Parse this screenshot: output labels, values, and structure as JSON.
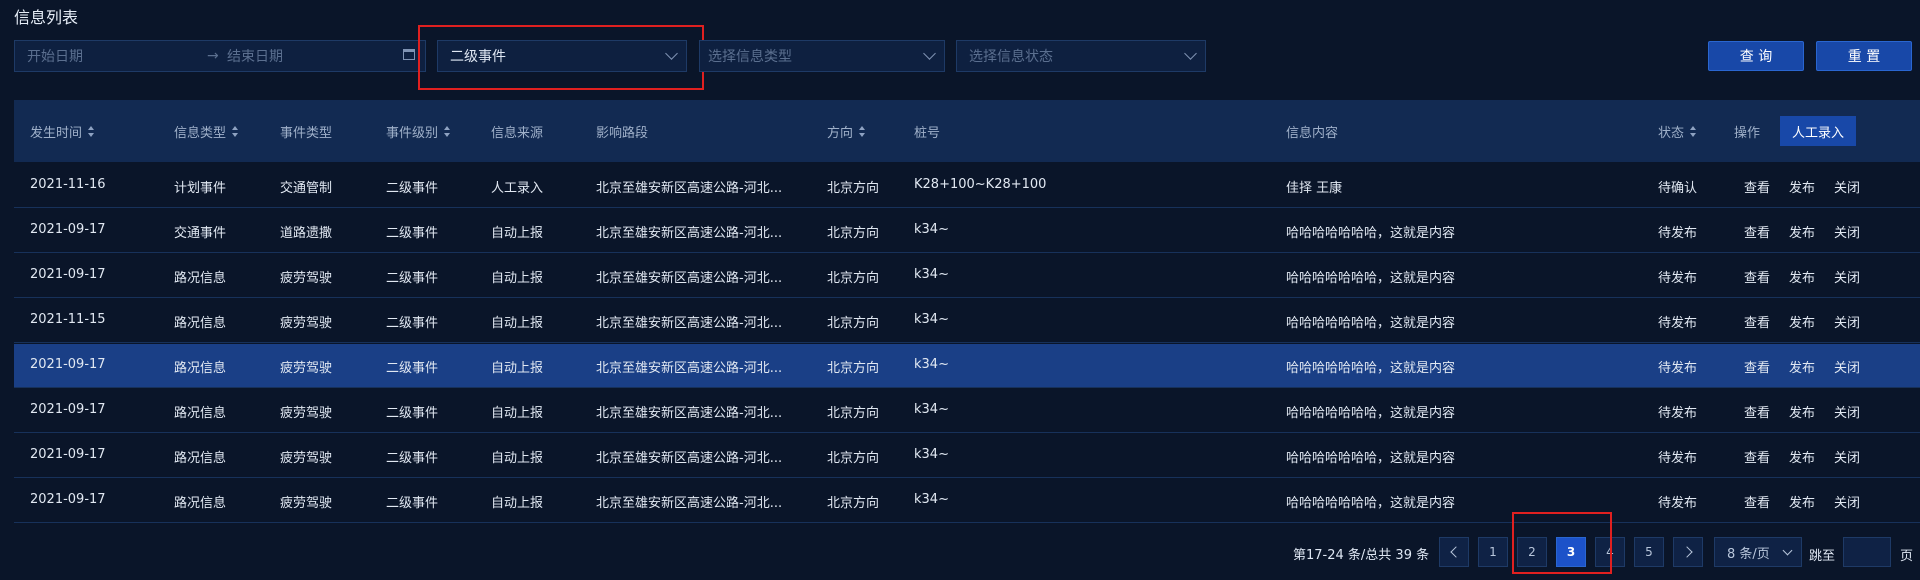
{
  "page_title": "信息列表",
  "filters": {
    "start_date_placeholder": "开始日期",
    "end_date_placeholder": "结束日期",
    "date_separator": "→",
    "event_level_value": "二级事件",
    "info_type_placeholder": "选择信息类型",
    "info_status_placeholder": "选择信息状态"
  },
  "buttons": {
    "query": "查 询",
    "reset": "重 置",
    "manual_entry": "人工录入"
  },
  "columns": [
    "发生时间",
    "信息类型",
    "事件类型",
    "事件级别",
    "信息来源",
    "影响路段",
    "方向",
    "桩号",
    "信息内容",
    "状态",
    "操作"
  ],
  "rows": [
    {
      "time": "2021-11-16",
      "info_type": "计划事件",
      "event_type": "交通管制",
      "level": "二级事件",
      "source": "人工录入",
      "road": "北京至雄安新区高速公路-河北...",
      "direction": "北京方向",
      "stake": "K28+100~K28+100",
      "content": "佳择 王康",
      "status": "待确认"
    },
    {
      "time": "2021-09-17",
      "info_type": "交通事件",
      "event_type": "道路遗撒",
      "level": "二级事件",
      "source": "自动上报",
      "road": "北京至雄安新区高速公路-河北...",
      "direction": "北京方向",
      "stake": "k34~",
      "content": "哈哈哈哈哈哈哈，这就是内容",
      "status": "待发布"
    },
    {
      "time": "2021-09-17",
      "info_type": "路况信息",
      "event_type": "疲劳驾驶",
      "level": "二级事件",
      "source": "自动上报",
      "road": "北京至雄安新区高速公路-河北...",
      "direction": "北京方向",
      "stake": "k34~",
      "content": "哈哈哈哈哈哈哈，这就是内容",
      "status": "待发布"
    },
    {
      "time": "2021-11-15",
      "info_type": "路况信息",
      "event_type": "疲劳驾驶",
      "level": "二级事件",
      "source": "自动上报",
      "road": "北京至雄安新区高速公路-河北...",
      "direction": "北京方向",
      "stake": "k34~",
      "content": "哈哈哈哈哈哈哈，这就是内容",
      "status": "待发布"
    },
    {
      "time": "2021-09-17",
      "info_type": "路况信息",
      "event_type": "疲劳驾驶",
      "level": "二级事件",
      "source": "自动上报",
      "road": "北京至雄安新区高速公路-河北...",
      "direction": "北京方向",
      "stake": "k34~",
      "content": "哈哈哈哈哈哈哈，这就是内容",
      "status": "待发布"
    },
    {
      "time": "2021-09-17",
      "info_type": "路况信息",
      "event_type": "疲劳驾驶",
      "level": "二级事件",
      "source": "自动上报",
      "road": "北京至雄安新区高速公路-河北...",
      "direction": "北京方向",
      "stake": "k34~",
      "content": "哈哈哈哈哈哈哈，这就是内容",
      "status": "待发布"
    },
    {
      "time": "2021-09-17",
      "info_type": "路况信息",
      "event_type": "疲劳驾驶",
      "level": "二级事件",
      "source": "自动上报",
      "road": "北京至雄安新区高速公路-河北...",
      "direction": "北京方向",
      "stake": "k34~",
      "content": "哈哈哈哈哈哈哈，这就是内容",
      "status": "待发布"
    },
    {
      "time": "2021-09-17",
      "info_type": "路况信息",
      "event_type": "疲劳驾驶",
      "level": "二级事件",
      "source": "自动上报",
      "road": "北京至雄安新区高速公路-河北...",
      "direction": "北京方向",
      "stake": "k34~",
      "content": "哈哈哈哈哈哈哈，这就是内容",
      "status": "待发布"
    }
  ],
  "row_actions": {
    "view": "查看",
    "publish": "发布",
    "close": "关闭"
  },
  "pagination": {
    "summary": "第17-24 条/总共 39 条",
    "pages": [
      "1",
      "2",
      "3",
      "4",
      "5"
    ],
    "current_page": "3",
    "page_size": "8 条/页",
    "jump_label": "跳至",
    "page_suffix": "页"
  },
  "colors": {
    "background": "#0a1529",
    "header": "#122a52",
    "highlight_row": "#1a3f86",
    "primary": "#1848a8",
    "annotation": "#e02020"
  }
}
